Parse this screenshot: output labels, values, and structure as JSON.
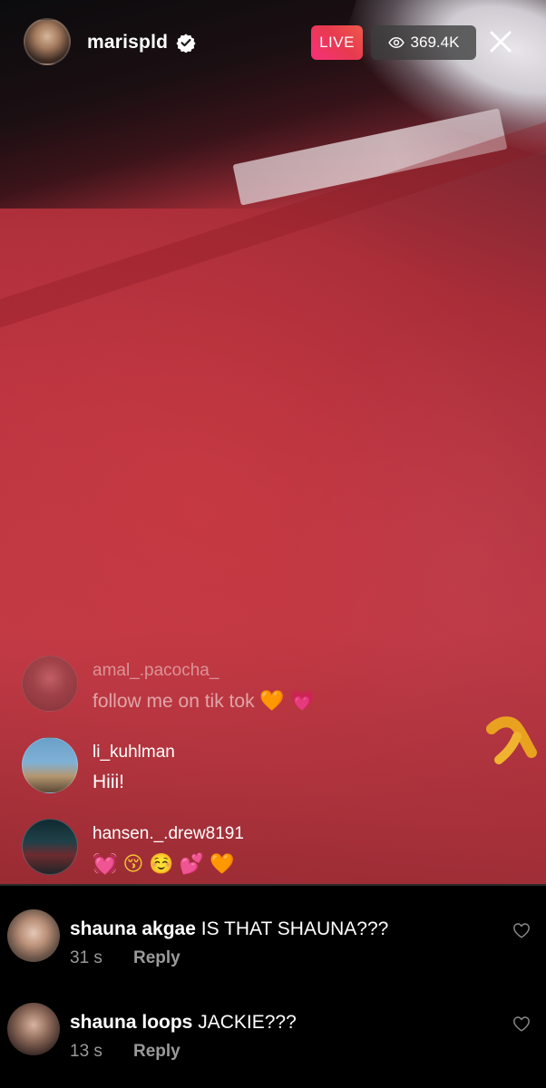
{
  "host": {
    "username": "marispld",
    "verified": true,
    "avatar_icon": "host-avatar"
  },
  "status": {
    "live_label": "LIVE",
    "viewers": "369.4K"
  },
  "live_comments": [
    {
      "username": "amal_.pacocha_",
      "message": "follow me on tik tok",
      "emojis": [
        "🧡",
        "💗"
      ]
    },
    {
      "username": "li_kuhlman",
      "message": "Hiii!",
      "emojis": []
    },
    {
      "username": "hansen._.drew8191",
      "message": "",
      "emojis": [
        "💓",
        "😚",
        "☺️",
        "💕",
        "🧡"
      ]
    }
  ],
  "panel_comments": [
    {
      "username": "shauna akgae",
      "text": "IS THAT SHAUNA???",
      "time": "31 s",
      "reply_label": "Reply"
    },
    {
      "username": "shauna loops",
      "text": "JACKIE???",
      "time": "13 s",
      "reply_label": "Reply"
    }
  ],
  "colors": {
    "live_badge": "#e83a4f",
    "video_red": "#bb3440",
    "secondary_text": "#9a9a9a"
  }
}
